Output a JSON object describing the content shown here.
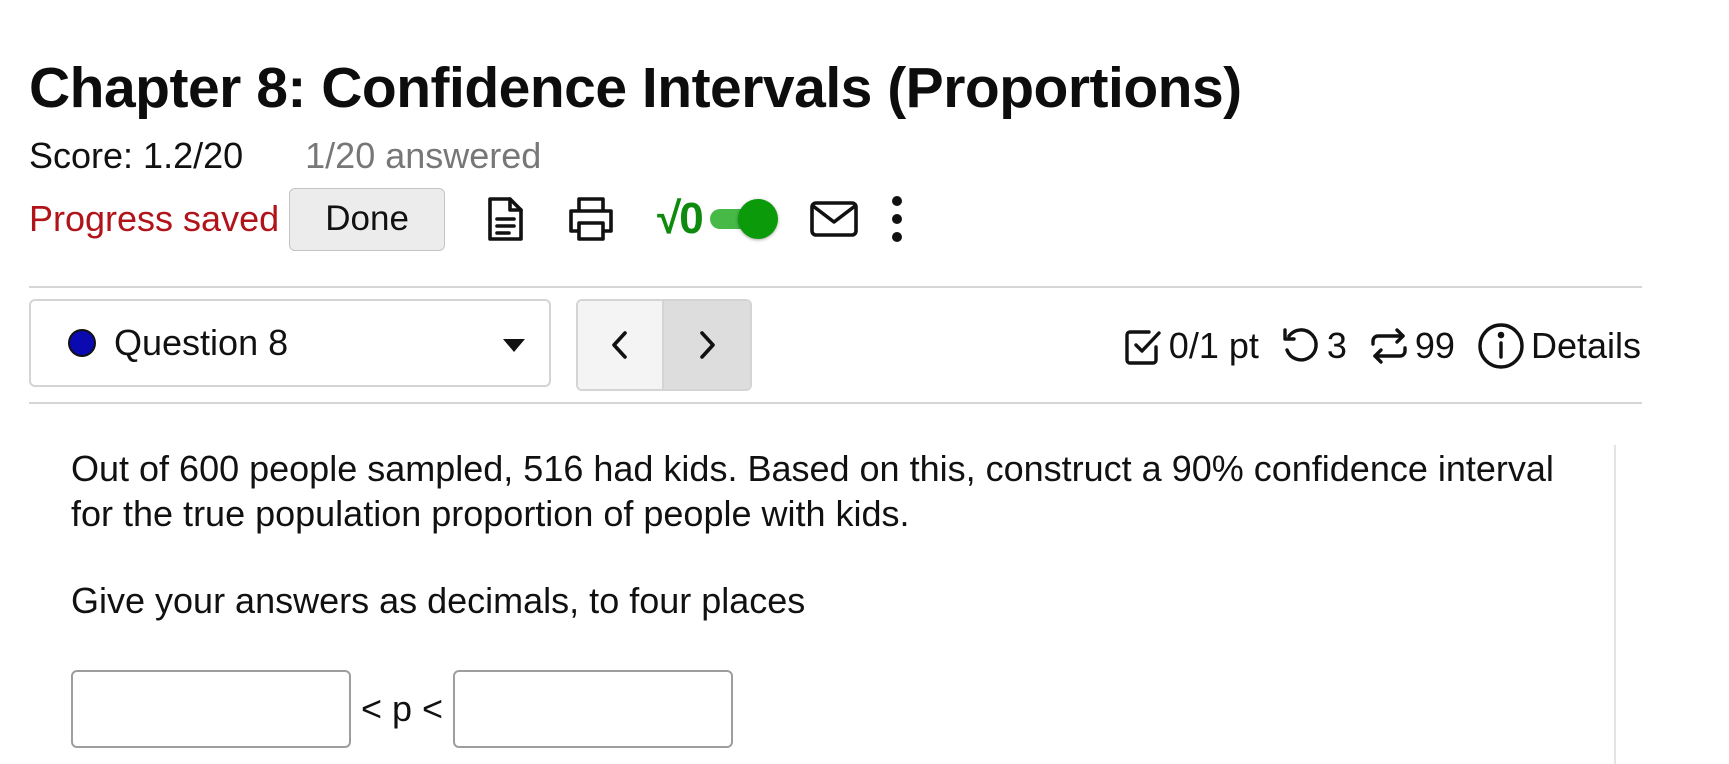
{
  "header": {
    "title": "Chapter 8: Confidence Intervals (Proportions)",
    "score": "Score: 1.2/20",
    "answered": "1/20 answered"
  },
  "toolbar": {
    "progress_status": "Progress saved",
    "done_label": "Done",
    "math_symbol": "√0",
    "math_toggle_on": true,
    "icons": [
      "document-icon",
      "print-icon",
      "math-entry-icon",
      "mail-icon",
      "more-vertical-icon"
    ]
  },
  "question_nav": {
    "selected_question": "Question 8",
    "status_dot_color": "#0a0ab0"
  },
  "meta": {
    "points": "0/1 pt",
    "tries": "3",
    "regens": "99",
    "details_label": "Details"
  },
  "question": {
    "text": "Out of 600 people sampled, 516 had kids. Based on this, construct a 90% confidence interval for the true population proportion of people with kids.",
    "instruction": "Give your answers as decimals, to four places",
    "inequality_symbol": "< p <",
    "lower_value": "",
    "upper_value": ""
  },
  "colors": {
    "progress_saved": "#b0141a",
    "math_green": "#0f8a0f",
    "toggle_green": "#0a9a0a"
  }
}
